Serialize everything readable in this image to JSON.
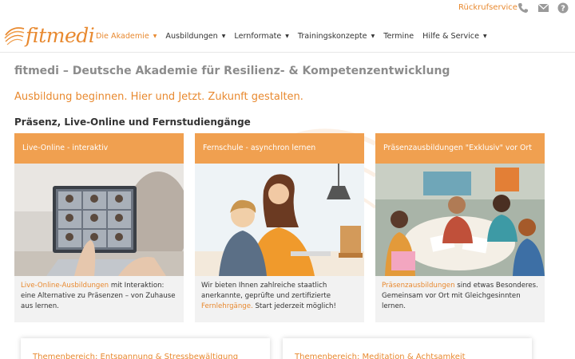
{
  "topbar": {
    "callback": "Rückrufservice",
    "icons": [
      "phone-icon",
      "mail-icon",
      "help-icon"
    ]
  },
  "header": {
    "logo_text": "fitmedi",
    "nav": [
      {
        "label": "Die Akademie",
        "active": true,
        "dropdown": true
      },
      {
        "label": "Ausbildungen",
        "active": false,
        "dropdown": true
      },
      {
        "label": "Lernformate",
        "active": false,
        "dropdown": true
      },
      {
        "label": "Trainingskonzepte",
        "active": false,
        "dropdown": true
      },
      {
        "label": "Termine",
        "active": false,
        "dropdown": false
      },
      {
        "label": "Hilfe & Service",
        "active": false,
        "dropdown": true
      }
    ]
  },
  "main": {
    "title": "fitmedi – Deutsche Akademie für Resilienz- & Kompetenzentwicklung",
    "tagline": "Ausbildung beginnen. Hier und Jetzt. Zukunft gestalten.",
    "section_title": "Präsenz, Live-Online und Fernstudiengänge",
    "cards": [
      {
        "title": "Live-Online - interaktiv",
        "text_link": "Live-Online-Ausbildungen",
        "text_1": " mit Interaktion: eine Alternative zu Präsenzen – von Zuhause aus lernen."
      },
      {
        "title": "Fernschule - asynchron lernen",
        "text_1": "Wir bieten Ihnen zahlreiche staatlich anerkannte, geprüfte und zertifizierte ",
        "text_link": "Fernlehrgänge.",
        "text_2": " Start jederzeit möglich!"
      },
      {
        "title": "Präsenzausbildungen \"Exklusiv\" vor Ort",
        "text_link": "Präsenzausbildungen",
        "text_1": " sind etwas Besonderes. Gemeinsam vor Ort mit Gleichgesinnten lernen."
      }
    ],
    "themes": [
      {
        "title": "Themenbereich: Entspannung & Stressbewältigung"
      },
      {
        "title": "Themenbereich: Meditation & Achtsamkeit"
      }
    ]
  },
  "colors": {
    "accent": "#e8892f",
    "card_header": "#f0a050",
    "card_bg": "#f2f2f2"
  }
}
